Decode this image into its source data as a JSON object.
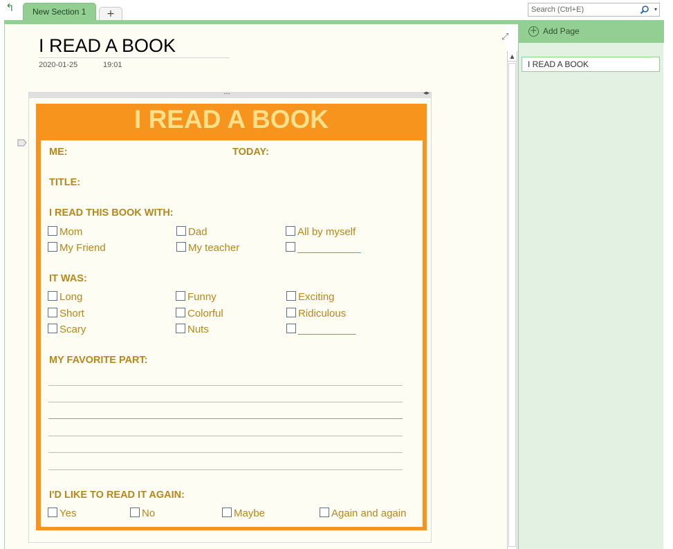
{
  "tabs": {
    "section_label": "New Section 1",
    "add_label": "+"
  },
  "search": {
    "placeholder": "Search (Ctrl+E)"
  },
  "page": {
    "title": "I READ A BOOK",
    "date": "2020-01-25",
    "time": "19:01"
  },
  "worksheet": {
    "title": "I READ A BOOK",
    "me_label": "ME:",
    "today_label": "TODAY:",
    "title_label": "TITLE:",
    "read_with_label": "I READ THIS BOOK WITH:",
    "read_with_options": [
      "Mom",
      "Dad",
      "All by myself",
      "My Friend",
      "My teacher",
      "___________"
    ],
    "it_was_label": "IT WAS:",
    "it_was_options": [
      "Long",
      "Funny",
      "Exciting",
      "Short",
      "Colorful",
      "Ridiculous",
      "Scary",
      "Nuts",
      "__________"
    ],
    "favorite_label": "MY FAVORITE PART:",
    "again_label": "I'D LIKE TO READ IT AGAIN:",
    "again_options": [
      "Yes",
      "No",
      "Maybe",
      "Again and again"
    ]
  },
  "pages_pane": {
    "add_page_label": "Add Page",
    "pages": [
      "I READ A BOOK"
    ]
  },
  "colors": {
    "accent_green": "#93cf93",
    "worksheet_orange": "#f7941d",
    "worksheet_title": "#ffe08a",
    "worksheet_text": "#b8861a"
  }
}
